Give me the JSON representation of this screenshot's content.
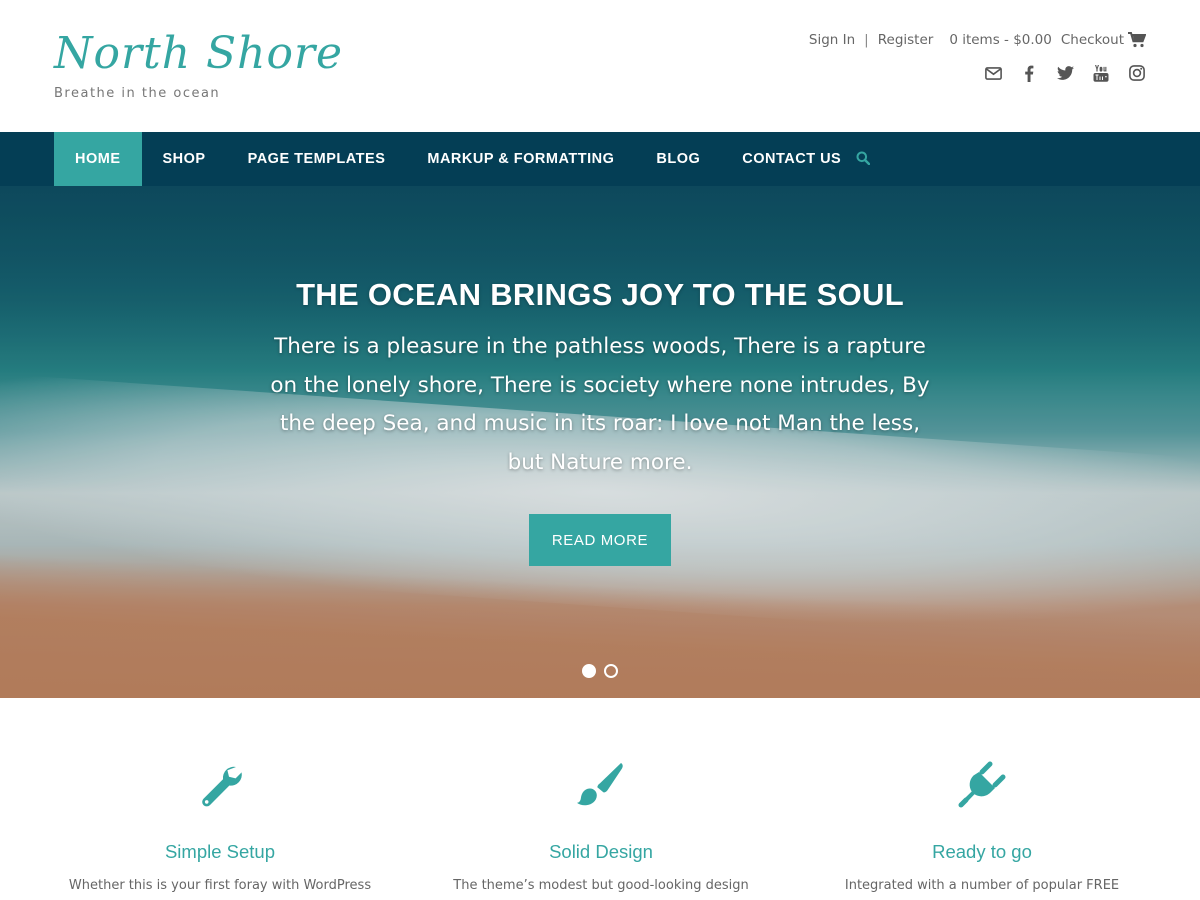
{
  "colors": {
    "accent": "#35a6a2",
    "nav_bg": "#043e55",
    "text": "#666666"
  },
  "header": {
    "site_title": "North Shore",
    "tagline": "Breathe in the ocean",
    "sign_in": "Sign In",
    "separator": "|",
    "register": "Register",
    "cart_summary": "0 items - $0.00",
    "checkout": "Checkout",
    "social_icons": [
      "envelope-icon",
      "facebook-icon",
      "twitter-icon",
      "youtube-icon",
      "instagram-icon"
    ]
  },
  "nav": {
    "items": [
      {
        "label": "HOME",
        "active": true
      },
      {
        "label": "SHOP"
      },
      {
        "label": "PAGE TEMPLATES"
      },
      {
        "label": "MARKUP & FORMATTING"
      },
      {
        "label": "BLOG"
      },
      {
        "label": "CONTACT US"
      }
    ],
    "search_icon": "search-icon"
  },
  "hero": {
    "title": "THE OCEAN BRINGS JOY TO THE SOUL",
    "text": "There is a pleasure in the pathless woods, There is a rapture on the lonely shore, There is society where none intrudes, By the deep Sea, and music in its roar: I love not Man the less, but Nature more.",
    "button": "READ MORE",
    "slides": 2,
    "active_slide": 1
  },
  "features": [
    {
      "icon": "wrench-icon",
      "title": "Simple Setup",
      "text": "Whether this is your first foray with WordPress"
    },
    {
      "icon": "paintbrush-icon",
      "title": "Solid Design",
      "text": "The theme’s modest but good-looking design"
    },
    {
      "icon": "plug-icon",
      "title": "Ready to go",
      "text": "Integrated with a number of popular FREE"
    }
  ]
}
